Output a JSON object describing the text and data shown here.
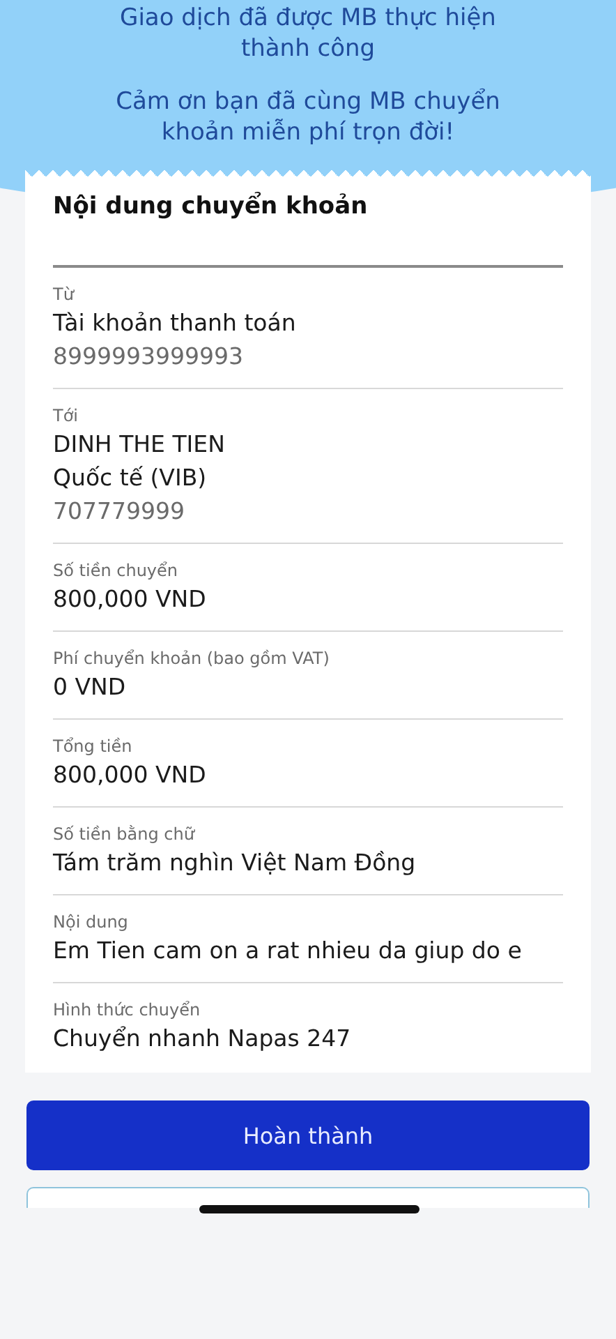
{
  "header": {
    "lines": [
      "Giao dịch đã được MB thực hiện",
      "thành công"
    ],
    "thanks": [
      "Cảm ơn bạn đã cùng MB chuyển",
      "khoản miễn phí trọn đời!"
    ]
  },
  "card": {
    "title": "Nội dung chuyển khoản",
    "rows": [
      {
        "label": "Từ",
        "lines": [
          {
            "text": "Tài khoản thanh toán",
            "kind": "main"
          },
          {
            "text": "8999993999993",
            "kind": "sub"
          }
        ]
      },
      {
        "label": "Tới",
        "lines": [
          {
            "text": "DINH THE TIEN",
            "kind": "main"
          },
          {
            "text": "Quốc tế (VIB)",
            "kind": "main"
          },
          {
            "text": "707779999",
            "kind": "sub"
          }
        ]
      },
      {
        "label": "Số tiền chuyển",
        "lines": [
          {
            "text": "800,000 VND",
            "kind": "main"
          }
        ]
      },
      {
        "label": "Phí chuyển khoản (bao gồm VAT)",
        "lines": [
          {
            "text": "0 VND",
            "kind": "main"
          }
        ]
      },
      {
        "label": "Tổng tiền",
        "lines": [
          {
            "text": "800,000 VND",
            "kind": "main"
          }
        ]
      },
      {
        "label": "Số tiền bằng chữ",
        "lines": [
          {
            "text": "Tám trăm nghìn Việt Nam Đồng",
            "kind": "main"
          }
        ]
      },
      {
        "label": "Nội dung",
        "lines": [
          {
            "text": "Em Tien cam on a rat nhieu da giup do e",
            "kind": "main"
          }
        ]
      },
      {
        "label": "Hình thức chuyển",
        "lines": [
          {
            "text": "Chuyển nhanh Napas 247",
            "kind": "main"
          }
        ]
      }
    ]
  },
  "buttons": [
    {
      "label": "Hoàn thành",
      "kind": "primary"
    }
  ]
}
